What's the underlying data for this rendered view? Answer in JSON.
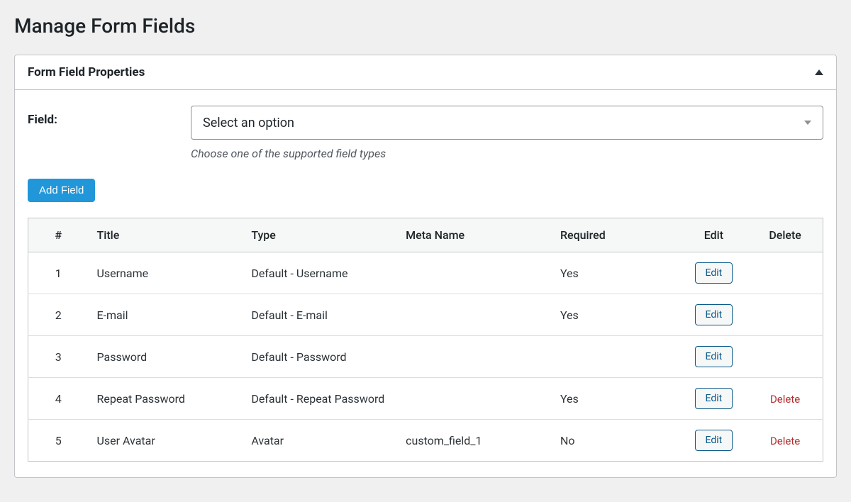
{
  "page_title": "Manage Form Fields",
  "panel": {
    "title": "Form Field Properties",
    "field": {
      "label": "Field:",
      "select_placeholder": "Select an option",
      "hint": "Choose one of the supported field types"
    },
    "add_button": "Add Field"
  },
  "table": {
    "headers": {
      "num": "#",
      "title": "Title",
      "type": "Type",
      "meta": "Meta Name",
      "required": "Required",
      "edit": "Edit",
      "delete": "Delete"
    },
    "edit_label": "Edit",
    "delete_label": "Delete",
    "rows": [
      {
        "num": "1",
        "title": "Username",
        "type": "Default - Username",
        "meta": "",
        "required": "Yes",
        "deletable": false
      },
      {
        "num": "2",
        "title": "E-mail",
        "type": "Default - E-mail",
        "meta": "",
        "required": "Yes",
        "deletable": false
      },
      {
        "num": "3",
        "title": "Password",
        "type": "Default - Password",
        "meta": "",
        "required": "",
        "deletable": false
      },
      {
        "num": "4",
        "title": "Repeat Password",
        "type": "Default - Repeat Password",
        "meta": "",
        "required": "Yes",
        "deletable": true
      },
      {
        "num": "5",
        "title": "User Avatar",
        "type": "Avatar",
        "meta": "custom_field_1",
        "required": "No",
        "deletable": true
      }
    ]
  }
}
